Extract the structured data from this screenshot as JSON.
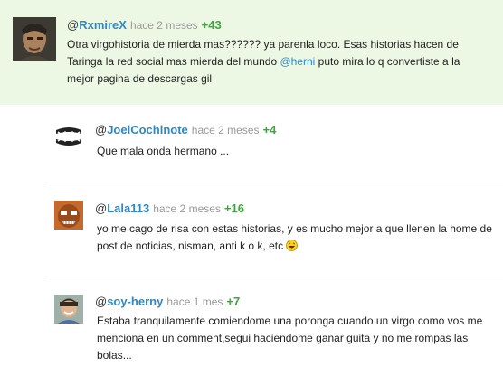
{
  "comments": [
    {
      "username": "RxmireX",
      "time": "hace 2 meses",
      "votes": "+43",
      "text_before": "Otra virgohistoria de mierda mas?????? ya parenla loco. Esas historias hacen de Taringa la red social mas mierda del mundo ",
      "mention": "@herni",
      "text_after": " puto mira lo q convertiste a la mejor pagina de descargas gil"
    },
    {
      "username": "JoelCochinote",
      "time": "hace 2 meses",
      "votes": "+4",
      "text": "Que mala onda hermano ..."
    },
    {
      "username": "Lala113",
      "time": "hace 2 meses",
      "votes": "+16",
      "text": "yo me cago de risa con estas historias, y es mucho mejor a que llenen la home de post de noticias, nisman, anti k o k, etc"
    },
    {
      "username": "soy-herny",
      "time": "hace 1 mes",
      "votes": "+7",
      "text": "Estaba tranquilamente comiendome una poronga cuando un virgo como vos me menciona en un comment,segui haciendome ganar guita y no me rompas las bolas..."
    }
  ],
  "at_symbol": "@",
  "icons": {
    "emoji": "laughing-emoji-icon",
    "avatar_1": "portrait-avatar",
    "avatar_2": "teeth-avatar",
    "avatar_3": "mask-avatar",
    "avatar_4": "photo-avatar"
  },
  "colors": {
    "username": "#2d88c9",
    "votes": "#3aa83a",
    "time": "#9a9a9a",
    "highlight_bg": "#ecf8e4"
  }
}
